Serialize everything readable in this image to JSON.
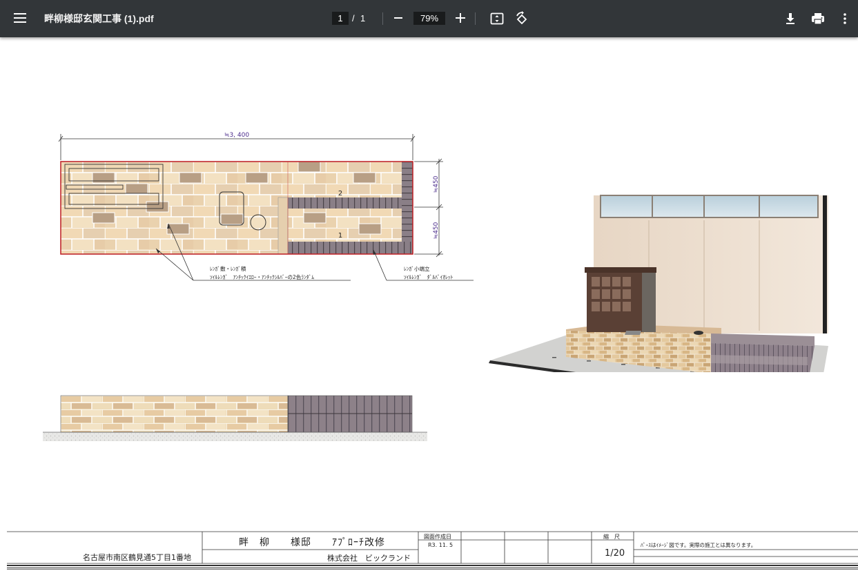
{
  "toolbar": {
    "title": "畔柳様邸玄関工事 (1).pdf",
    "page_current": "1",
    "page_separator": "/",
    "page_total": "1",
    "zoom": "79%"
  },
  "drawing": {
    "dimension_width": "≒3, 400",
    "dimension_height_upper": "≒450",
    "dimension_height_lower": "≒450",
    "label_step_2": "2",
    "label_step_1": "1",
    "note_left_line1": "ﾚﾝｶﾞ敷・ﾚﾝｶﾞ積",
    "note_left_line2": "ｿｲﾙﾚﾝｶﾞ　ｱﾝﾁｯｸｲｴﾛｰ・ｱﾝﾁｯｸｼﾙﾊﾞｰの2色ﾗﾝﾀﾞﾑ",
    "note_right_line1": "ﾚﾝｶﾞ小端立",
    "note_right_line2": "ｿｲﾙﾚﾝｶﾞ　ﾀﾞﾙﾊﾞｲｵﾚｯﾄ"
  },
  "title_block": {
    "address": "名古屋市南区鶴見通5丁目1番地",
    "project_name": "畔　柳　　様邸　　ｱﾌﾟﾛｰﾁ改修",
    "company": "株式会社　ビックランド",
    "date_label": "図面作成日",
    "date_value": "R3. 11. 5",
    "scale_label": "縮　尺",
    "scale_value": "1/20",
    "note": "ﾊﾟｰｽはｲﾒｰｼﾞ図です。実際の施工とは異なります。"
  },
  "colors": {
    "toolbar_bg": "#323639",
    "dimension_text": "#4b2c8c",
    "outline_red": "#c0262b",
    "brick_light": "#ecd7b3",
    "brick_dark": "#b59a7e",
    "violet_brick": "#7a6d76"
  }
}
